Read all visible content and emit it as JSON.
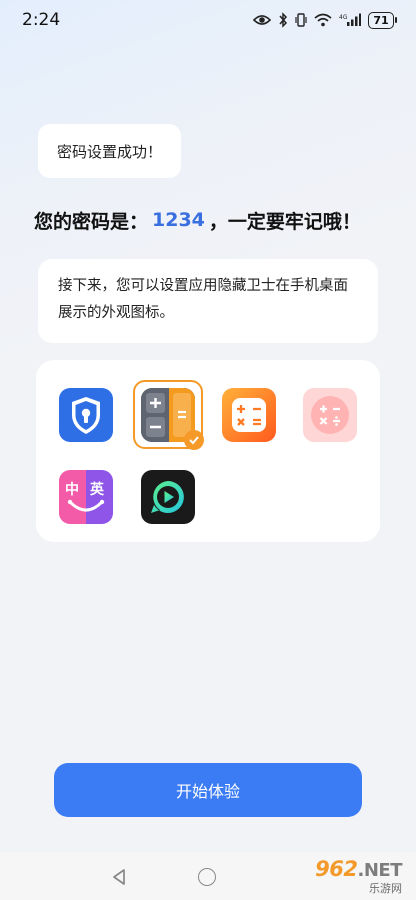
{
  "status_bar": {
    "time": "2:24",
    "battery": "71",
    "network_label": "4G",
    "icons": [
      "eye-icon",
      "bluetooth-icon",
      "vibrate-icon",
      "wifi-icon",
      "signal-icon",
      "battery-icon"
    ]
  },
  "bubble": {
    "text": "密码设置成功！"
  },
  "headline": {
    "prefix": "您的密码是：",
    "password": "1234",
    "suffix": "，一定要牢记哦！",
    "password_color": "#3a6fe0"
  },
  "info": {
    "text": "接下来，您可以设置应用隐藏卫士在手机桌面展示的外观图标。"
  },
  "icons": {
    "selected": "calculator-icon",
    "items": [
      {
        "name": "shield-lock-icon",
        "selected": false
      },
      {
        "name": "calculator-icon",
        "selected": true
      },
      {
        "name": "orange-calculator-icon",
        "selected": false
      },
      {
        "name": "pink-calculator-icon",
        "selected": false
      },
      {
        "name": "translator-icon",
        "selected": false,
        "label_a": "中",
        "label_b": "英"
      },
      {
        "name": "video-player-icon",
        "selected": false
      }
    ],
    "accent_color": "#f59a28"
  },
  "start_button": {
    "label": "开始体验",
    "color": "#3b7cf4"
  },
  "watermark": {
    "brand": "962",
    "tld": ".NET",
    "sub": "乐游网"
  }
}
